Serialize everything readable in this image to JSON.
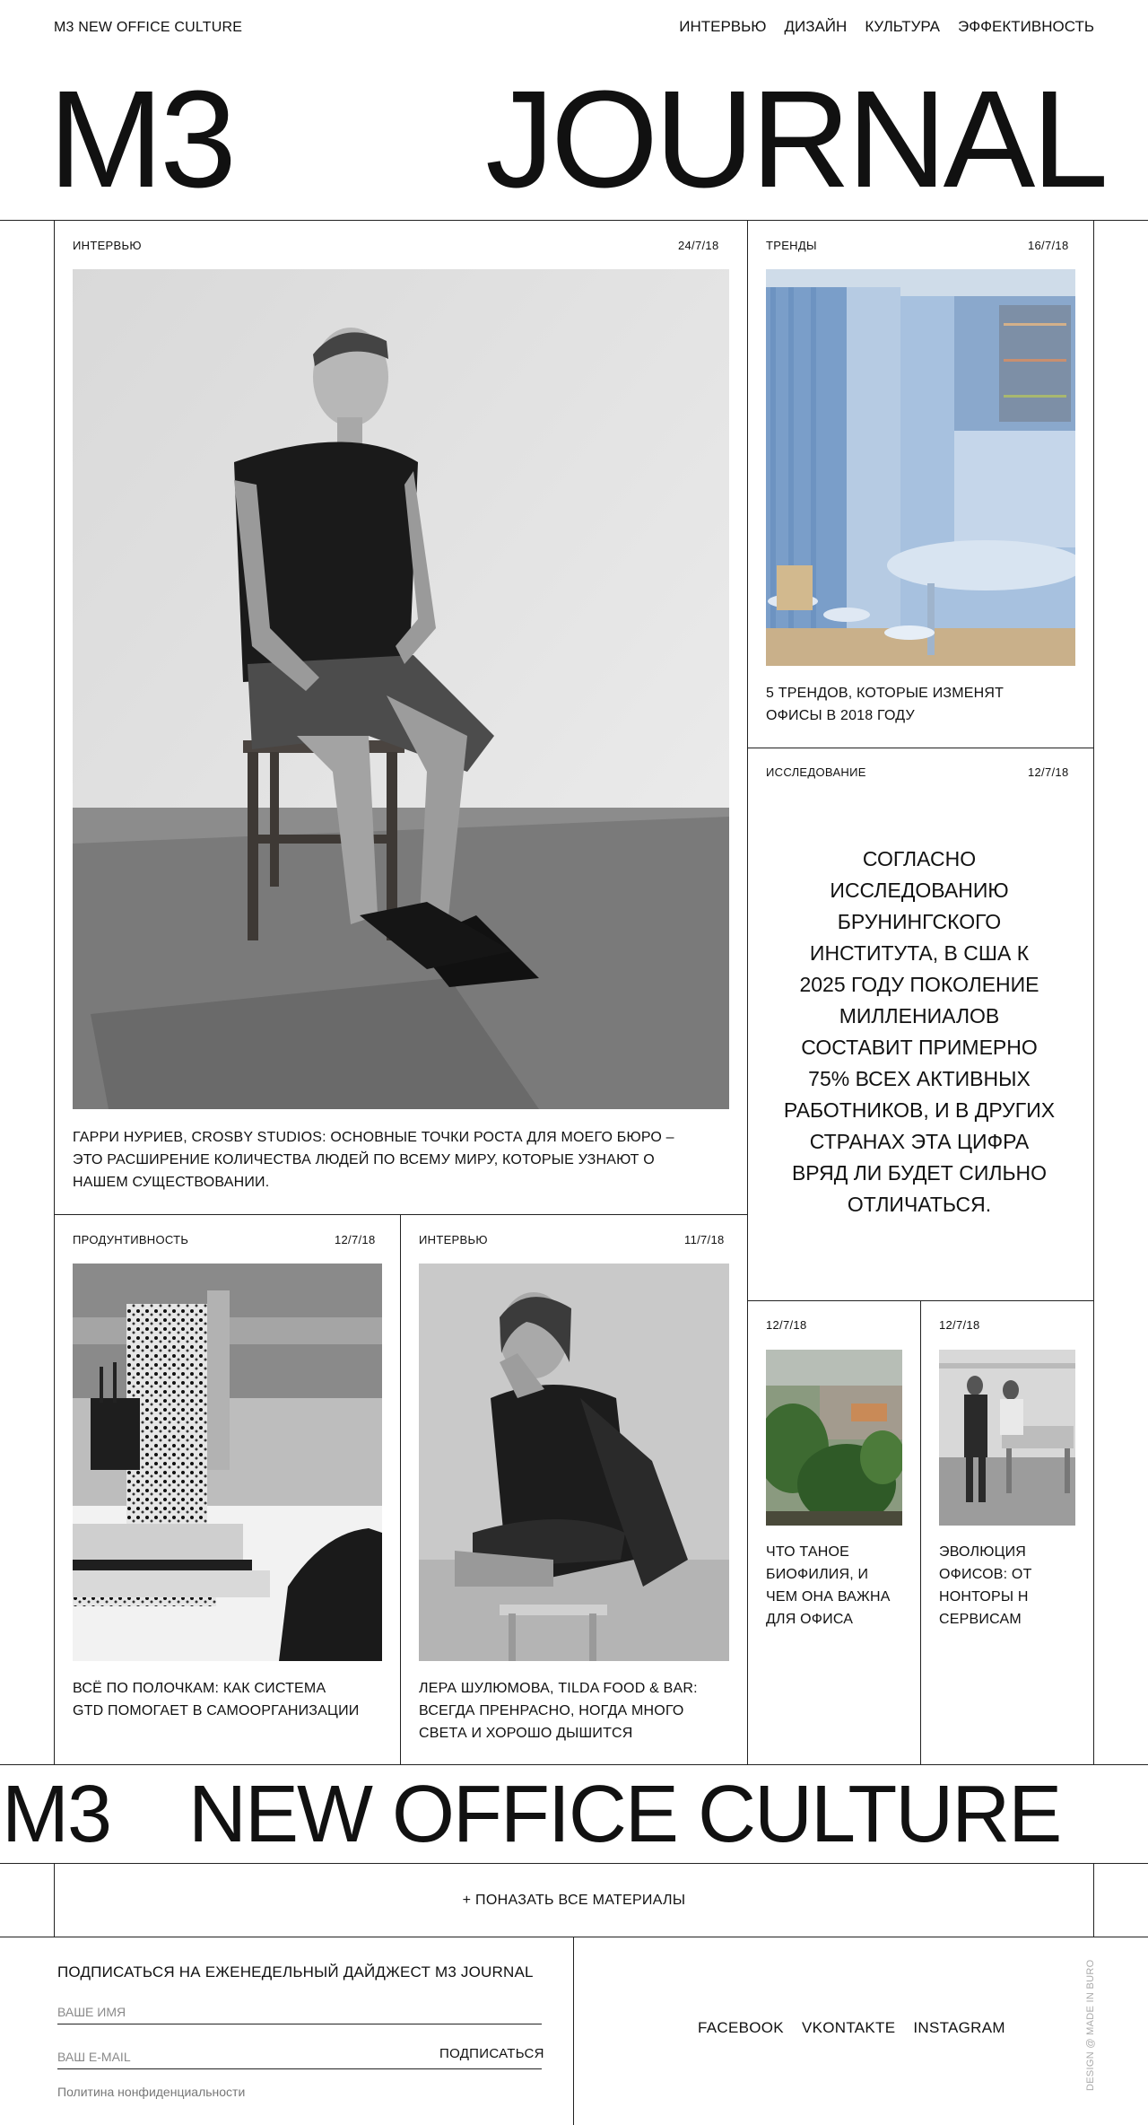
{
  "header": {
    "site_name": "M3 NEW OFFICE CULTURE",
    "nav": [
      "ИНТЕРВЬЮ",
      "ДИЗАЙН",
      "КУЛЬТУРА",
      "ЭФФЕКТИВНОСТЬ"
    ],
    "masthead_left": "M3",
    "masthead_right": "JOURNAL"
  },
  "cards": {
    "main": {
      "category": "ИНТЕРВЬЮ",
      "date": "24/7/18",
      "caption_1": "ГАРРИ НУРИЕВ, CROSBY STUDIOS: ОСНОВНЫЕ ТОЧКИ РОСТА ДЛЯ МОЕГО БЮРО –",
      "caption_2": "ЭТО РАСШИРЕНИЕ КОЛИЧЕСТВА ЛЮДЕЙ ПО ВСЕМУ МИРУ, КОТОРЫЕ УЗНАЮТ О",
      "caption_3": "НАШЕМ СУЩЕСТВОВАНИИ."
    },
    "trends": {
      "category": "ТРЕНДЫ",
      "date": "16/7/18",
      "caption_1": "5 ТРЕНДОВ, КОТОРЫЕ ИЗМЕНЯТ",
      "caption_2": "ОФИСЫ В 2018 ГОДУ"
    },
    "research": {
      "category": "ИССЛЕДОВАНИЕ",
      "date": "12/7/18",
      "quote": [
        "СОГЛАСНО",
        "ИССЛЕДОВАНИЮ",
        "БРУНИНГСКОГО",
        "ИНСТИТУТА, В США К",
        "2025 ГОДУ ПОКОЛЕНИЕ",
        "МИЛЛЕНИАЛОВ",
        "СОСТАВИТ ПРИМЕРНО",
        "75% ВСЕХ АКТИВНЫХ",
        "РАБОТНИКОВ, И В ДРУГИХ",
        "СТРАНАХ ЭТА ЦИФРА",
        "ВРЯД ЛИ БУДЕТ СИЛЬНО",
        "ОТЛИЧАТЬСЯ."
      ]
    },
    "productivity": {
      "category": "ПРОДУНТИВНОСТЬ",
      "date": "12/7/18",
      "caption_1": "ВСЁ ПО ПОЛОЧКАМ: КАК СИСТЕМА",
      "caption_2": "GTD ПОМОГАЕТ В САМООРГАНИЗАЦИИ"
    },
    "interview2": {
      "category": "ИНТЕРВЬЮ",
      "date": "11/7/18",
      "caption_1": "ЛЕРА ШУЛЮМОВА, TILDA FOOD & BAR:",
      "caption_2": "ВСЕГДА ПРЕНРАСНО, НОГДА МНОГО",
      "caption_3": "СВЕТА И ХОРОШО ДЫШИТСЯ"
    },
    "biophilia": {
      "date": "12/7/18",
      "caption": [
        "ЧТО ТАНОЕ",
        "БИОФИЛИЯ, И",
        "ЧЕМ ОНА ВАЖНА",
        "ДЛЯ ОФИСА"
      ]
    },
    "evolution": {
      "date": "12/7/18",
      "caption": [
        "ЭВОЛЮЦИЯ",
        "ОФИСОВ: ОТ",
        "НОНТОРЫ Н",
        "СЕРВИСАМ"
      ]
    }
  },
  "banner": {
    "left": "M3",
    "right": "NEW OFFICE CULTURE"
  },
  "show_all": "+ ПОНАЗАТЬ ВСЕ МАТЕРИАЛЫ",
  "subscribe": {
    "title": "ПОДПИСАТЬСЯ НА ЕЖЕНЕДЕЛЬНЫЙ ДАЙДЖЕСТ M3 JOURNAL",
    "name_placeholder": "ВАШЕ ИМЯ",
    "email_placeholder": "ВАШ E-MAIL",
    "button": "ПОДПИСАТЬСЯ",
    "privacy": "Политина нонфиденциальности"
  },
  "socials": [
    "FACEBOOK",
    "VKONTAKTE",
    "INSTAGRAM"
  ],
  "credit": "DESIGN @ MADE IN BURO",
  "colors": {
    "text": "#111111",
    "lines": "#222222",
    "muted": "#8a8a8a",
    "photo_blue": "#8fb0d8"
  }
}
